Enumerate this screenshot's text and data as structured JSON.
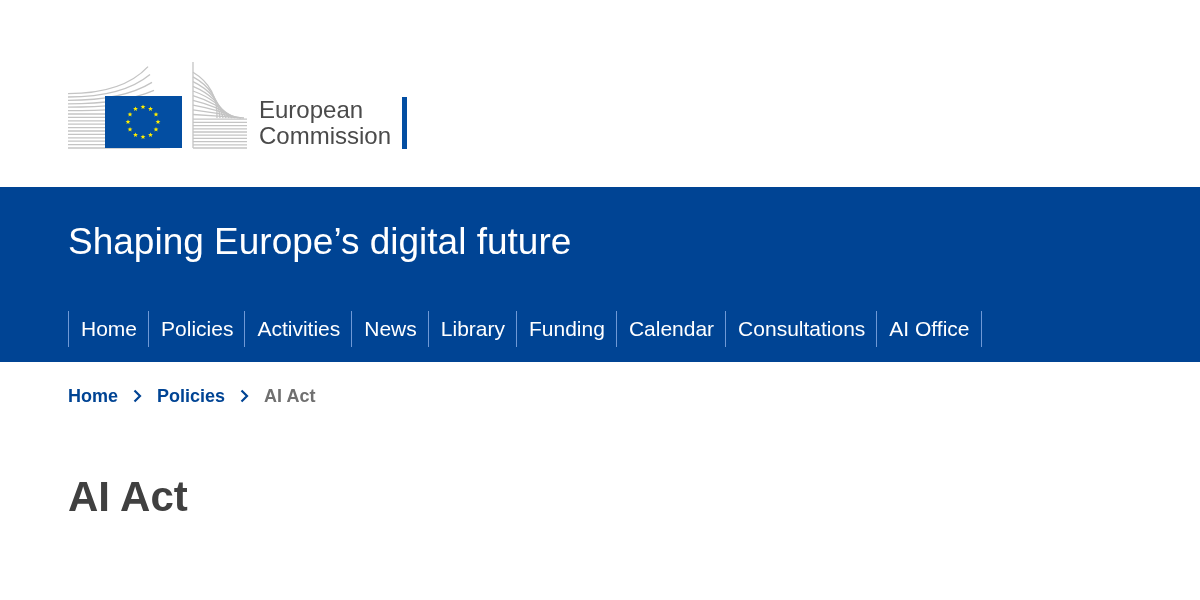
{
  "header": {
    "logo_text": "European Commission"
  },
  "banner": {
    "site_title": "Shaping Europe’s digital future",
    "nav": [
      "Home",
      "Policies",
      "Activities",
      "News",
      "Library",
      "Funding",
      "Calendar",
      "Consultations",
      "AI Office"
    ]
  },
  "breadcrumb": [
    {
      "label": "Home",
      "kind": "link"
    },
    {
      "label": "Policies",
      "kind": "link"
    },
    {
      "label": "AI Act",
      "kind": "current"
    }
  ],
  "page": {
    "title": "AI Act"
  }
}
